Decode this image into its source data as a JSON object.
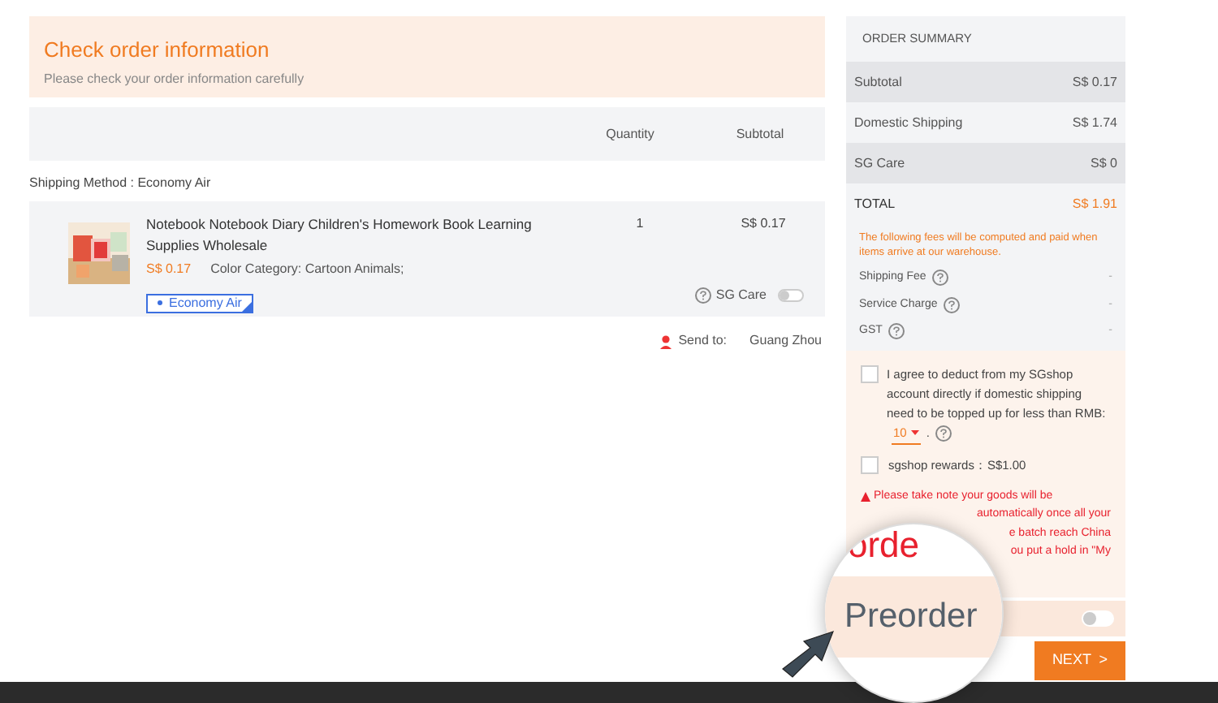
{
  "header": {
    "title": "Check order information",
    "subtitle": "Please check your order information carefully"
  },
  "table": {
    "columns": [
      "Quantity",
      "Subtotal"
    ]
  },
  "shipping_method": "Shipping Method : Economy Air",
  "item": {
    "title": "Notebook Notebook Diary Children's Homework Book Learning Supplies Wholesale",
    "price": "S$ 0.17",
    "variant": "Color Category: Cartoon Animals;",
    "shipping": "Economy Air",
    "quantity": "1",
    "subtotal": "S$ 0.17",
    "sg_care": {
      "label": "SG Care",
      "on": false
    }
  },
  "send_to": {
    "label": "Send to:",
    "city": "Guang Zhou"
  },
  "summary": {
    "title": "ORDER SUMMARY",
    "rows": [
      {
        "label": "Subtotal",
        "value": "S$ 0.17",
        "kind": "shaded"
      },
      {
        "label": "Domestic Shipping",
        "value": "S$ 1.74",
        "kind": "plain"
      },
      {
        "label": "SG Care",
        "value": "S$ 0",
        "kind": "shaded"
      },
      {
        "label": "TOTAL",
        "value": "S$ 1.91",
        "kind": "total"
      }
    ],
    "fees_note": "The following fees will be computed and paid when items arrive at our warehouse.",
    "fees": [
      {
        "label": "Shipping Fee",
        "value": "-"
      },
      {
        "label": "Service Charge",
        "value": "-"
      },
      {
        "label": "GST",
        "value": "-"
      }
    ],
    "agree": {
      "checked": false,
      "text": "I agree to deduct from my SGshop account directly if domestic shipping need to be topped up for less than RMB:",
      "amount": "10",
      "after": "."
    },
    "rewards": {
      "checked": false,
      "text": "sgshop rewards：S$1.00"
    },
    "notice": [
      "Please take note your goods will be",
      "automatically once all your",
      "e batch reach China",
      "ou put a hold in \"My"
    ],
    "preorder": {
      "on": false
    },
    "next_button": "NEXT  >"
  },
  "magnifier": {
    "top_text": "orde",
    "label": "Preorder"
  }
}
